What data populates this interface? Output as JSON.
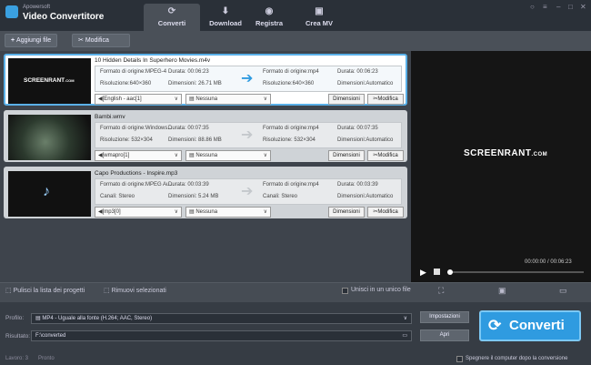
{
  "app": {
    "brand": "Apowersoft",
    "title": "Video Convertitore"
  },
  "tabs": [
    {
      "label": "Converti",
      "icon": "refresh-icon"
    },
    {
      "label": "Download",
      "icon": "download-icon"
    },
    {
      "label": "Registra",
      "icon": "record-icon"
    },
    {
      "label": "Crea MV",
      "icon": "tv-icon"
    }
  ],
  "toolbar": {
    "add_label": "Aggiungi file",
    "edit_label": "Modifica"
  },
  "items": [
    {
      "filename": "10 Hidden Details In Superhero Movies.m4v",
      "src_format": "Formato di origine:MPEG-4",
      "src_duration": "Durata: 00:06:23",
      "src_res": "Risoluzione:640×360",
      "src_size": "Dimensioni: 26.71 MB",
      "dst_format": "Formato di origine:mp4",
      "dst_duration": "Durata: 00:06:23",
      "dst_res": "Risoluzione:640×360",
      "dst_size": "Dimensioni:Automatico",
      "audio": "[English - aac[1]",
      "subtitle": "Nessuna",
      "btn_size": "Dimensioni",
      "btn_edit": "Modifica"
    },
    {
      "filename": "Bambi.wmv",
      "src_format": "Formato di origine:Windows...",
      "src_duration": "Durata: 00:07:35",
      "src_res": "Risoluzione: 532×304",
      "src_size": "Dimensioni: 88.86 MB",
      "dst_format": "Formato di origine:mp4",
      "dst_duration": "Durata: 00:07:35",
      "dst_res": "Risoluzione: 532×304",
      "dst_size": "Dimensioni:Automatico",
      "audio": "[wmapro[1]",
      "subtitle": "Nessuna",
      "btn_size": "Dimensioni",
      "btn_edit": "Modifica"
    },
    {
      "filename": "Capo Productions - Inspire.mp3",
      "src_format": "Formato di origine:MPEG Au...",
      "src_duration": "Durata: 00:03:39",
      "src_res": "Canali: Stereo",
      "src_size": "Dimensioni: 5.24 MB",
      "dst_format": "Formato di origine:mp4",
      "dst_duration": "Durata: 00:03:39",
      "dst_res": "Canali: Stereo",
      "dst_size": "Dimensioni:Automatico",
      "audio": "[mp3[0]",
      "subtitle": "Nessuna",
      "btn_size": "Dimensioni",
      "btn_edit": "Modifica"
    }
  ],
  "preview": {
    "logo": "SCREENRANT",
    "logo_suffix": ".COM",
    "time": "00:00:00 / 00:06:23",
    "progress": 0.0
  },
  "actions": {
    "clear": "Pulisci la lista dei progetti",
    "remove": "Rimuovi selezionati",
    "merge": "Unisci in un unico file"
  },
  "output": {
    "profile_label": "Profilo:",
    "profile_value": "MP4 - Uguale alla fonte (H.264; AAC, Stereo)",
    "settings_btn": "Impostazioni",
    "result_label": "Risultato:",
    "result_value": "F:\\converted",
    "open_btn": "Apri",
    "convert_btn": "Converti",
    "shutdown": "Spegnere il computer dopo la conversione"
  },
  "status": {
    "jobs": "Lavoro: 3",
    "state": "Pronto"
  },
  "colors": {
    "accent": "#2f9be0",
    "selection": "#5ab0e8"
  }
}
